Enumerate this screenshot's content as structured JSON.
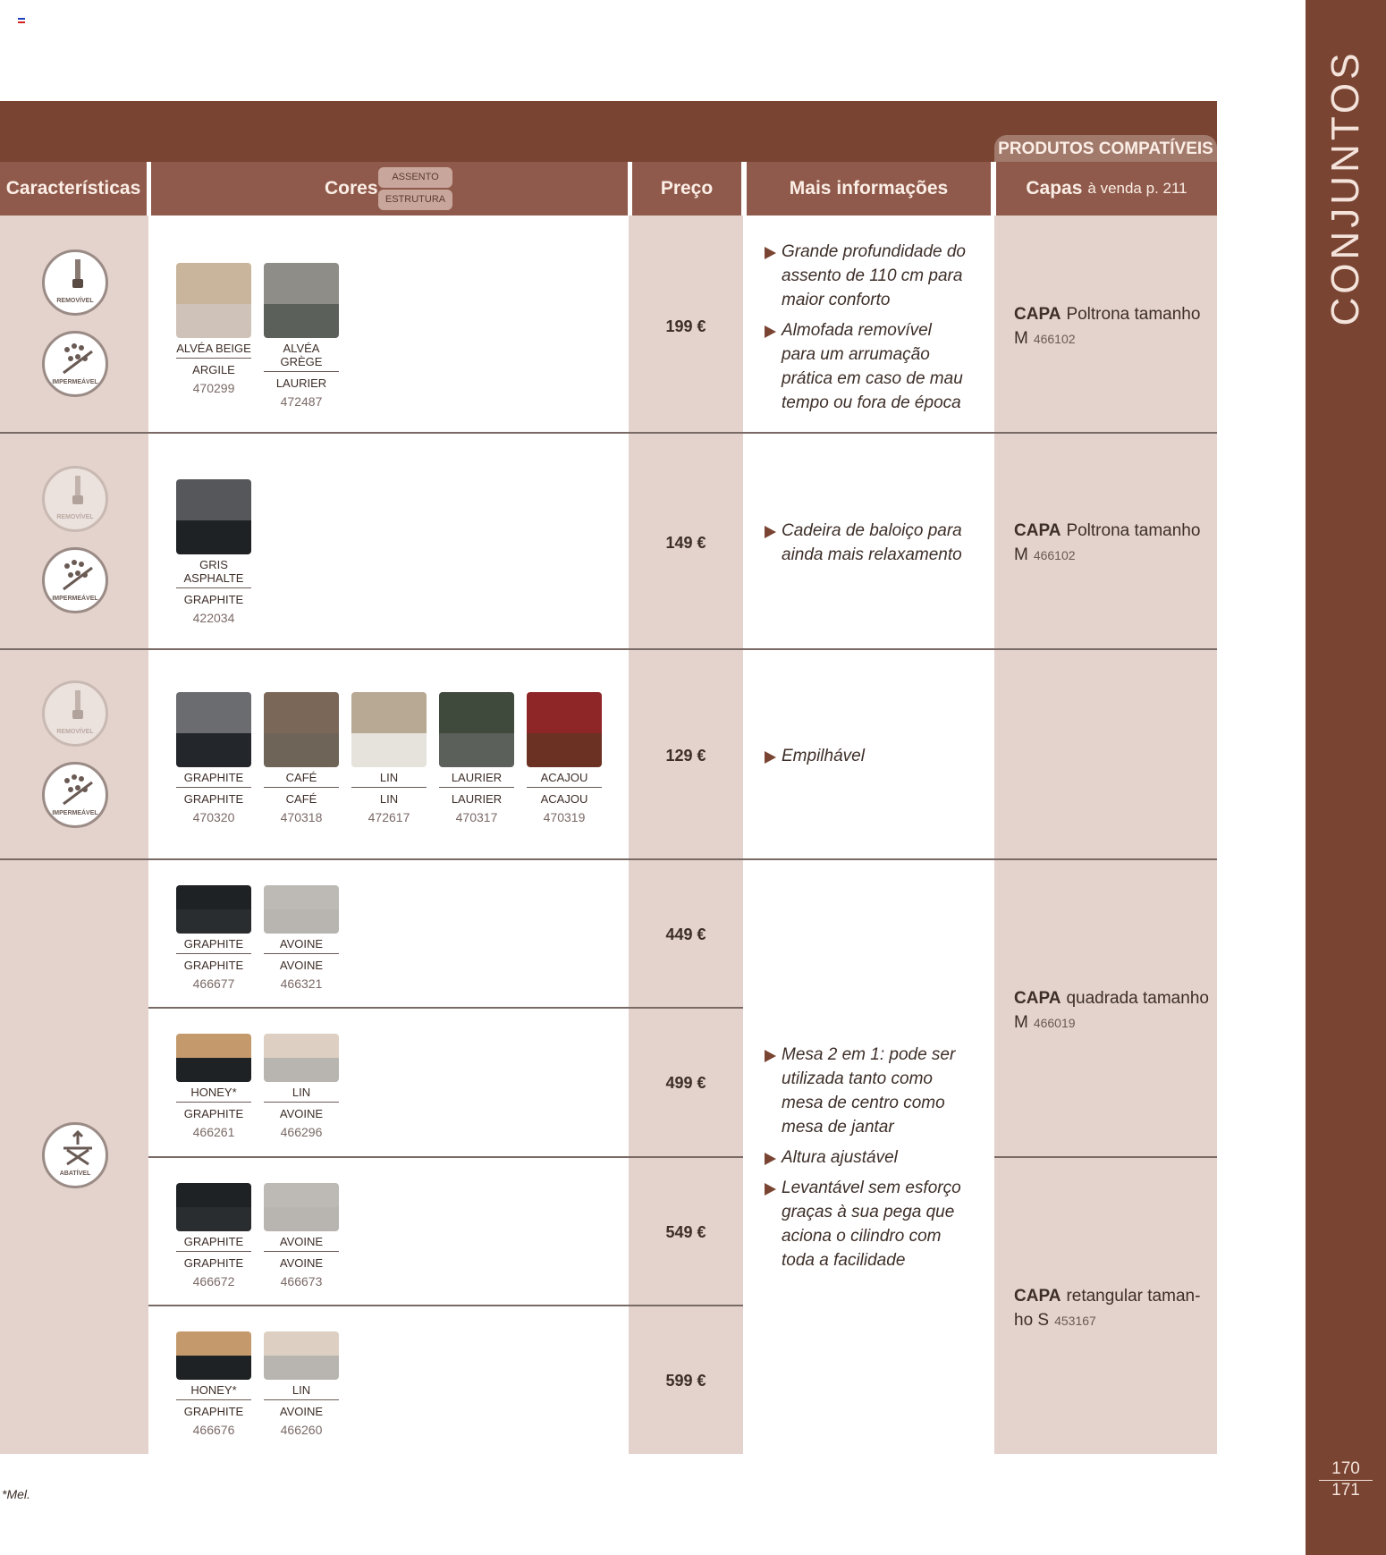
{
  "flag": [
    "#1f3fbf",
    "#ffffff",
    "#d42020"
  ],
  "sidebar": {
    "title": "CONJUNTOS",
    "page_left": "170",
    "page_right": "171"
  },
  "header": {
    "compatible_products": "PRODUTOS COMPATÍVEIS",
    "caracteristicas": "Características",
    "cores": "Cores",
    "assento": "ASSENTO",
    "estrutura": "ESTRUTURA",
    "preco": "Preço",
    "mais_info": "Mais informações",
    "capas": "Capas",
    "capas_sub": "à venda p. 211"
  },
  "icons": {
    "removivel": "REMOVÍVEL",
    "impermeavel": "IMPERMEÁVEL",
    "abativel": "ABATÍVEL"
  },
  "rows": [
    {
      "price": "199 €",
      "info": [
        "Grande profundidade do assento de 110 cm para maior conforto",
        "Almofada removível para um arrumação prática em caso de mau tempo ou fora de época"
      ],
      "capa_label": "CAPA",
      "capa_text": "Poltrona tamanho M",
      "capa_code": "466102",
      "swatches": [
        {
          "seat": "ALVÉA BEIGE",
          "frame": "ARGILE",
          "code": "470299",
          "top": "#c9b59b",
          "bottom": "#cfc3b9"
        },
        {
          "seat": "ALVÉA GRÈGE",
          "frame": "LAURIER",
          "code": "472487",
          "top": "#8f8d87",
          "bottom": "#5c605a"
        }
      ]
    },
    {
      "price": "149 €",
      "info": [
        "Cadeira de baloiço para ainda mais relaxamento"
      ],
      "capa_label": "CAPA",
      "capa_text": "Poltrona tamanho M",
      "capa_code": "466102",
      "swatches": [
        {
          "seat": "GRIS ASPHALTE",
          "frame": "GRAPHITE",
          "code": "422034",
          "top": "#55575a",
          "bottom": "#1f2224"
        }
      ]
    },
    {
      "price": "129 €",
      "info": [
        "Empilhável"
      ],
      "swatches": [
        {
          "seat": "GRAPHITE",
          "frame": "GRAPHITE",
          "code": "470320",
          "top": "#6a6c70",
          "bottom": "#23262a"
        },
        {
          "seat": "CAFÉ",
          "frame": "CAFÉ",
          "code": "470318",
          "top": "#7b6758",
          "bottom": "#6e6558"
        },
        {
          "seat": "LIN",
          "frame": "LIN",
          "code": "472617",
          "top": "#b7a994",
          "bottom": "#e6e2dc"
        },
        {
          "seat": "LAURIER",
          "frame": "LAURIER",
          "code": "470317",
          "top": "#3f4a3d",
          "bottom": "#5b605a"
        },
        {
          "seat": "ACAJOU",
          "frame": "ACAJOU",
          "code": "470319",
          "top": "#8e2527",
          "bottom": "#6b3224"
        }
      ]
    },
    {
      "price": "449 €",
      "swatches": [
        {
          "seat": "GRAPHITE",
          "frame": "GRAPHITE",
          "code": "466677",
          "top": "#1f2224",
          "bottom": "#2a2d30"
        },
        {
          "seat": "AVOINE",
          "frame": "AVOINE",
          "code": "466321",
          "top": "#bdbab5",
          "bottom": "#b8b5b0"
        }
      ]
    },
    {
      "price": "499 €",
      "swatches": [
        {
          "seat": "HONEY*",
          "frame": "GRAPHITE",
          "code": "466261",
          "top": "#c49a6c",
          "bottom": "#1f2224"
        },
        {
          "seat": "LIN",
          "frame": "AVOINE",
          "code": "466296",
          "top": "#ddd0c2",
          "bottom": "#b8b5b0"
        }
      ]
    },
    {
      "price": "549 €",
      "swatches": [
        {
          "seat": "GRAPHITE",
          "frame": "GRAPHITE",
          "code": "466672",
          "top": "#1f2224",
          "bottom": "#2a2d30"
        },
        {
          "seat": "AVOINE",
          "frame": "AVOINE",
          "code": "466673",
          "top": "#bdbab5",
          "bottom": "#b8b5b0"
        }
      ]
    },
    {
      "price": "599 €",
      "swatches": [
        {
          "seat": "HONEY*",
          "frame": "GRAPHITE",
          "code": "466676",
          "top": "#c49a6c",
          "bottom": "#1f2224"
        },
        {
          "seat": "LIN",
          "frame": "AVOINE",
          "code": "466260",
          "top": "#ddd0c2",
          "bottom": "#b8b5b0"
        }
      ]
    }
  ],
  "table_info": [
    "Mesa 2 em 1: pode ser utilizada tanto como mesa de centro como mesa de jantar",
    "Altura ajustável",
    "Levantável sem esforço graças à sua pega que aciona o cilindro com toda a facilidade"
  ],
  "table_capa_1": {
    "label": "CAPA",
    "text": "quadrada tamanho M",
    "code": "466019"
  },
  "table_capa_2": {
    "label": "CAPA",
    "text": "retangular taman-ho S",
    "code": "453167"
  },
  "footnote": "*Mel."
}
